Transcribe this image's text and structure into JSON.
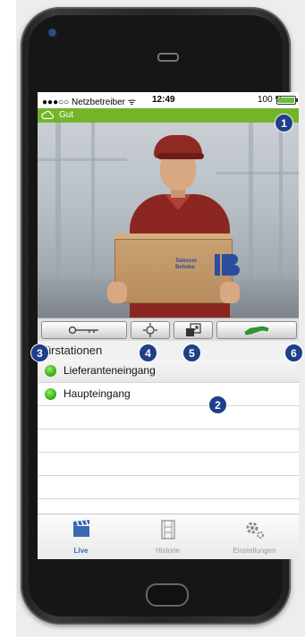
{
  "status_bar": {
    "carrier": "●●●○○ Netzbetreiber ᯤ",
    "time": "12:49",
    "battery_pct": "100 %",
    "battery_level": 1.0
  },
  "connection": {
    "label": "Gut",
    "color": "#74b42a"
  },
  "video": {
    "box_logo_text": "Telecom Behnke"
  },
  "controls": {
    "key_icon": "key-icon",
    "light_icon": "light-icon",
    "camera_switch_icon": "camera-switch-icon",
    "call_icon": "phone-call-icon"
  },
  "stations": {
    "header": "Türstationen",
    "items": [
      {
        "name": "Lieferanteneingang",
        "status_color": "#3fae1a"
      },
      {
        "name": "Haupteingang",
        "status_color": "#3fae1a"
      }
    ]
  },
  "tabs": [
    {
      "label": "Live",
      "icon": "live-camera-icon"
    },
    {
      "label": "Historie",
      "icon": "history-film-icon"
    },
    {
      "label": "Einstellungen",
      "icon": "gear-icon"
    }
  ],
  "callouts": [
    "1",
    "2",
    "3",
    "4",
    "5",
    "6"
  ],
  "colors": {
    "accent_blue": "#1f3f88",
    "ok_green": "#74b42a",
    "call_green": "#2e9a2e"
  }
}
